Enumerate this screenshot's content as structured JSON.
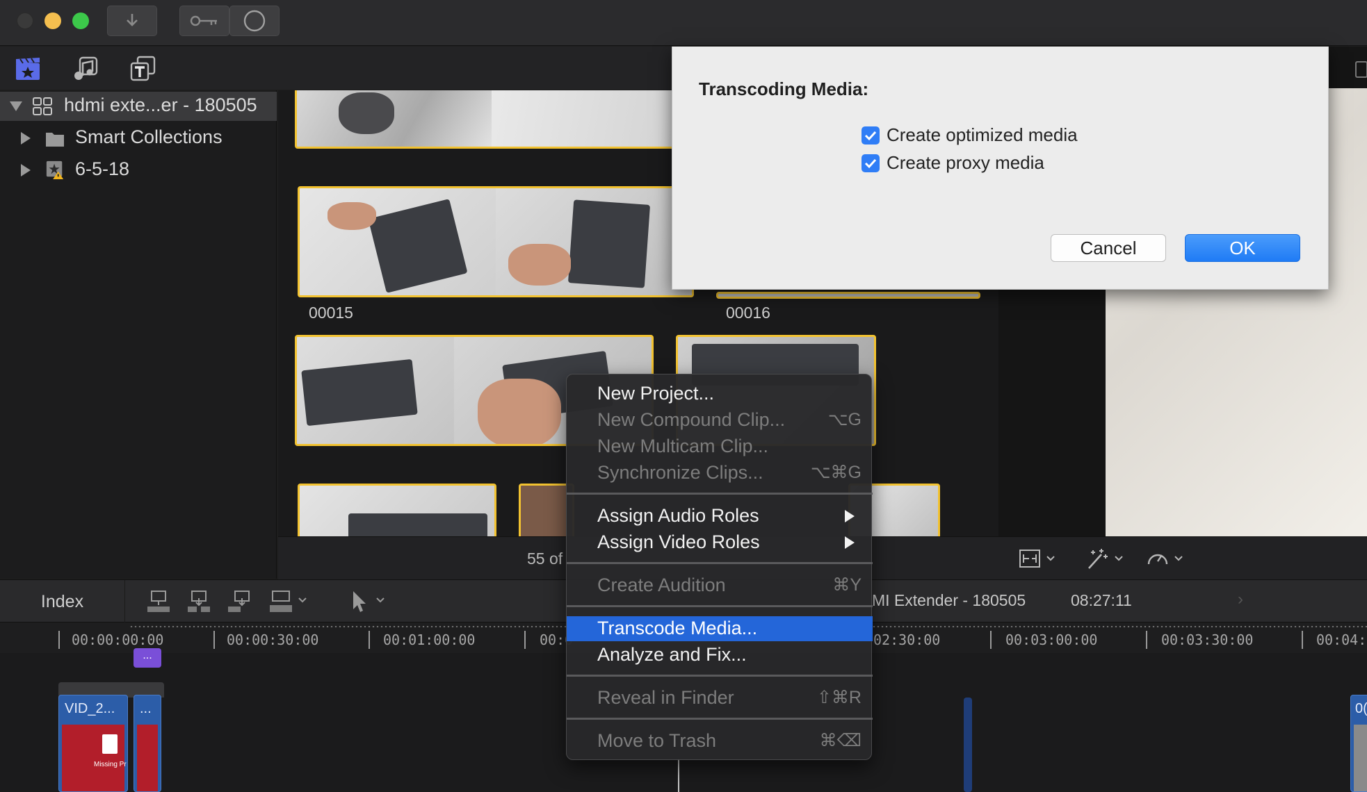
{
  "toolbar": {
    "import_icon": "download-arrow-icon",
    "keywords_icon": "key-icon",
    "background_tasks_icon": "circle-icon"
  },
  "library_tabs": {
    "libraries_icon": "clapperboard-star-icon",
    "photos_audio_icon": "music-note-icon",
    "titles_icon": "titles-T-icon"
  },
  "sidebar": {
    "items": [
      {
        "label": "hdmi exte...er - 180505",
        "icon": "library-grid-icon"
      },
      {
        "label": "Smart Collections",
        "icon": "folder-icon"
      },
      {
        "label": "6-5-18",
        "icon": "event-star-warning-icon"
      }
    ]
  },
  "browser": {
    "clips": [
      {
        "label": "00015"
      },
      {
        "label": "00016"
      }
    ],
    "count_text": "55 of"
  },
  "dialog": {
    "title": "Transcoding Media:",
    "options": [
      {
        "label": "Create optimized media",
        "checked": true
      },
      {
        "label": "Create proxy media",
        "checked": true
      }
    ],
    "cancel_label": "Cancel",
    "ok_label": "OK",
    "accent": "#2f7df6"
  },
  "context_menu": {
    "items": [
      {
        "label": "New Project...",
        "shortcut": "",
        "enabled": true
      },
      {
        "label": "New Compound Clip...",
        "shortcut": "⌥G",
        "enabled": false
      },
      {
        "label": "New Multicam Clip...",
        "shortcut": "",
        "enabled": false
      },
      {
        "label": "Synchronize Clips...",
        "shortcut": "⌥⌘G",
        "enabled": false
      },
      {
        "label": "Assign Audio Roles",
        "shortcut": "",
        "enabled": true,
        "submenu": true
      },
      {
        "label": "Assign Video Roles",
        "shortcut": "",
        "enabled": true,
        "submenu": true
      },
      {
        "label": "Create Audition",
        "shortcut": "⌘Y",
        "enabled": false
      },
      {
        "label": "Transcode Media...",
        "shortcut": "",
        "enabled": true,
        "highlighted": true
      },
      {
        "label": "Analyze and Fix...",
        "shortcut": "",
        "enabled": true
      },
      {
        "label": "Reveal in Finder",
        "shortcut": "⇧⌘R",
        "enabled": false
      },
      {
        "label": "Move to Trash",
        "shortcut": "⌘⌫",
        "enabled": false
      }
    ],
    "highlight_color": "#2466d9"
  },
  "timeline_toolbar": {
    "index_label": "Index",
    "project_name": "MI Extender - 180505",
    "duration": "08:27:11",
    "edit_icons": [
      "connect-clip-icon",
      "insert-clip-icon",
      "append-clip-icon",
      "overwrite-clip-icon",
      "select-arrow-tool-icon"
    ]
  },
  "viewer_footer": {
    "icons": [
      "clip-appearance-icon",
      "magic-wand-enhance-icon",
      "speedometer-retime-icon"
    ]
  },
  "ruler": {
    "ticks": [
      "00:00:00:00",
      "00:00:30:00",
      "00:01:00:00",
      "00:0",
      "02:30:00",
      "00:03:00:00",
      "00:03:30:00",
      "00:04:"
    ]
  },
  "timeline": {
    "marker_label": "...",
    "clips": [
      {
        "name": "VID_2..."
      },
      {
        "name": "..."
      }
    ],
    "missing_text": "Missing Pr",
    "edge_clip_label": "0("
  }
}
